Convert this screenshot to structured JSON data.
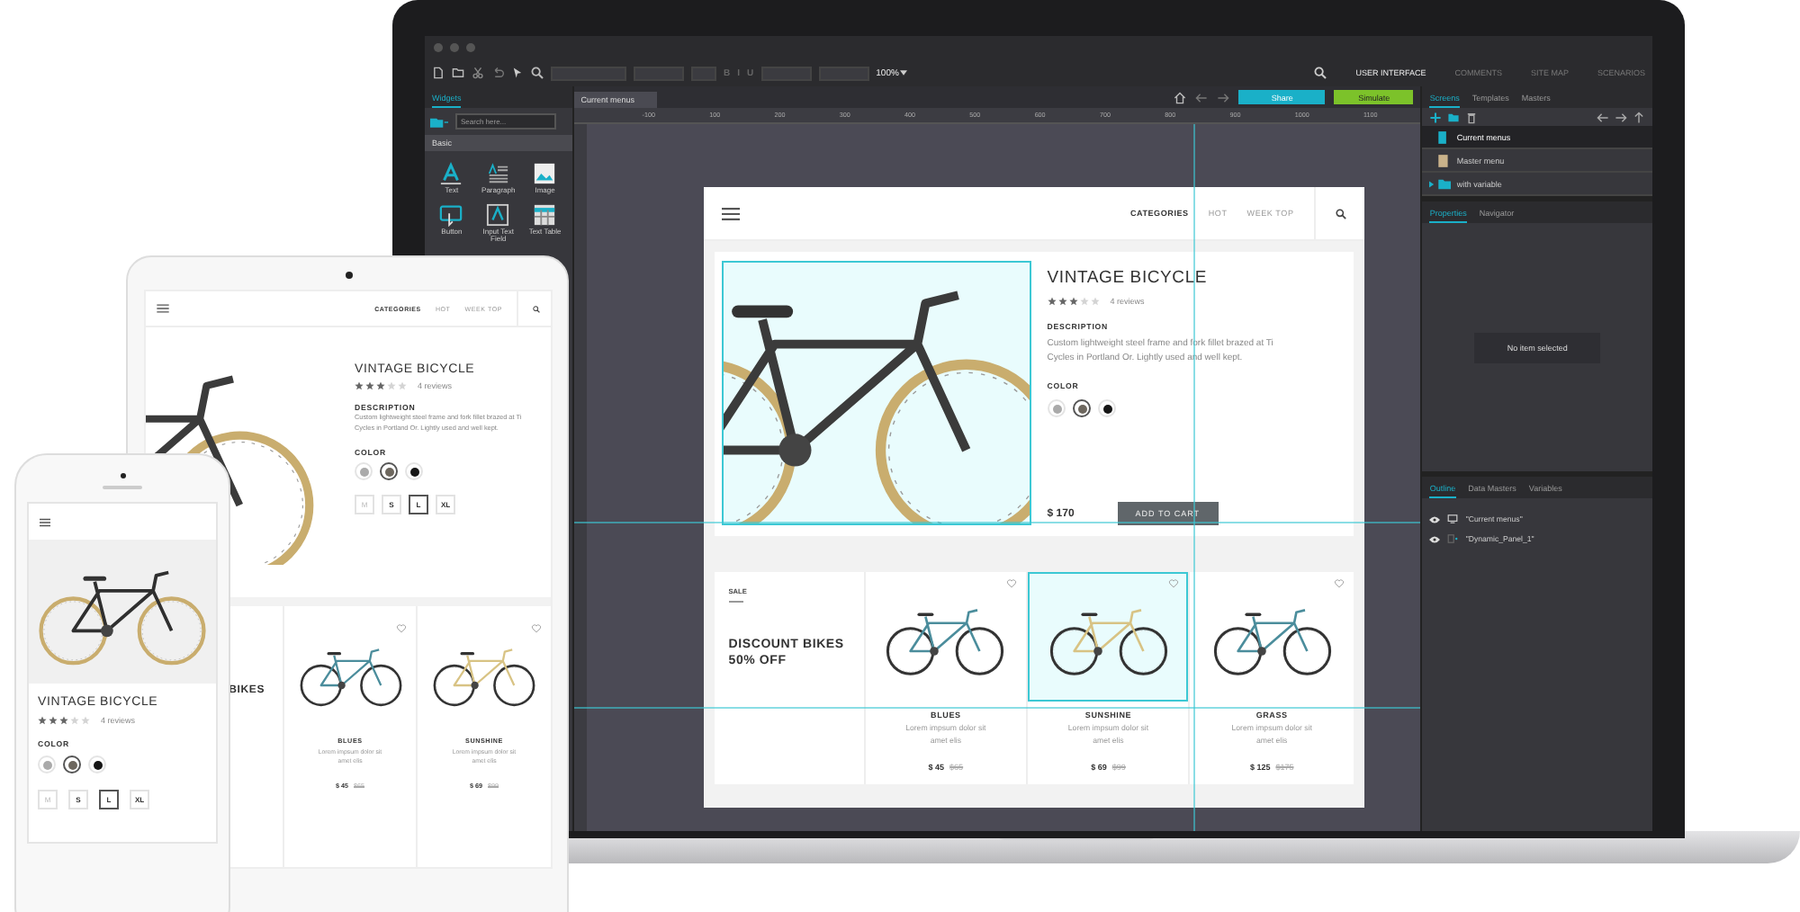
{
  "laptop": {
    "toolbar": {
      "format_buttons": [
        "B",
        "I",
        "U"
      ],
      "zoom": "100%",
      "modes": [
        {
          "label": "USER INTERFACE",
          "selected": true
        },
        {
          "label": "COMMENTS",
          "selected": false
        },
        {
          "label": "SITE MAP",
          "selected": false
        },
        {
          "label": "SCENARIOS",
          "selected": false
        }
      ]
    },
    "widgets_panel": {
      "tab": "Widgets",
      "search": {
        "placeholder": "Search here..."
      },
      "category": "Basic",
      "widgets": [
        {
          "label": "Text",
          "kind": "text"
        },
        {
          "label": "Paragraph",
          "kind": "paragraph"
        },
        {
          "label": "Image",
          "kind": "image"
        },
        {
          "label": "Button",
          "kind": "button"
        },
        {
          "label": "Input Text Field",
          "kind": "input"
        },
        {
          "label": "Text Table",
          "kind": "table"
        }
      ]
    },
    "document_tab": "Current menus",
    "share_button": "Share",
    "simulate_button": "Simulate",
    "ruler": [
      "-100",
      "100",
      "200",
      "300",
      "400",
      "500",
      "600",
      "700",
      "800",
      "900",
      "1000",
      "1100"
    ],
    "page": {
      "nav": [
        {
          "label": "CATEGORIES",
          "selected": true
        },
        {
          "label": "HOT",
          "selected": false
        },
        {
          "label": "WEEK TOP",
          "selected": false
        }
      ],
      "product": {
        "image_selected": true,
        "title": "VINTAGE BICYCLE",
        "stars": 3,
        "reviews": "4 reviews",
        "description_heading": "DESCRIPTION",
        "description": "Custom lightweight steel frame and fork fillet brazed at Ti Cycles in Portland Or. Lightly used and well kept.",
        "color_heading": "COLOR",
        "colors": [
          {
            "color": "#aaaaaa",
            "selected": false
          },
          {
            "color": "#6d675e",
            "selected": true
          },
          {
            "color": "#161616",
            "selected": false
          }
        ],
        "price": "$ 170",
        "cart_button": "ADD TO CART"
      },
      "sale": {
        "label": "SALE",
        "title": "DISCOUNT BIKES 50% OFF"
      },
      "products": [
        {
          "name": "BLUES",
          "description": "Lorem impsum dolor sit amet elis",
          "price": "$ 45",
          "old_price": "$65",
          "color": "#4b8d9c",
          "selected": false
        },
        {
          "name": "SUNSHINE",
          "description": "Lorem impsum dolor sit amet elis",
          "price": "$ 69",
          "old_price": "$99",
          "color": "#d8c384",
          "selected": true
        },
        {
          "name": "GRASS",
          "description": "Lorem impsum dolor sit amet elis",
          "price": "$ 125",
          "old_price": "$175",
          "color": "#4b8d9c",
          "selected": false
        }
      ]
    },
    "screens_panel": {
      "tabs": [
        {
          "label": "Screens",
          "selected": true
        },
        {
          "label": "Templates",
          "selected": false
        },
        {
          "label": "Masters",
          "selected": false
        }
      ],
      "items": [
        {
          "label": "Current menus",
          "kind": "screen",
          "selected": true
        },
        {
          "label": "Master menu",
          "kind": "master",
          "selected": false
        },
        {
          "label": "with variable",
          "kind": "folder",
          "selected": false
        }
      ]
    },
    "properties_panel": {
      "tabs": [
        {
          "label": "Properties",
          "selected": true
        },
        {
          "label": "Navigator",
          "selected": false
        }
      ],
      "empty_message": "No item selected"
    },
    "outline_panel": {
      "tabs": [
        {
          "label": "Outline",
          "selected": true
        },
        {
          "label": "Data Masters",
          "selected": false
        },
        {
          "label": "Variables",
          "selected": false
        }
      ],
      "items": [
        {
          "label": "\"Current menus\"",
          "kind": "screen"
        },
        {
          "label": "\"Dynamic_Panel_1\"",
          "kind": "panel"
        }
      ]
    }
  },
  "tablet": {
    "nav": [
      {
        "label": "CATEGORIES",
        "selected": true
      },
      {
        "label": "HOT",
        "selected": false
      },
      {
        "label": "WEEK TOP",
        "selected": false
      }
    ],
    "product": {
      "title": "VINTAGE BICYCLE",
      "stars": 3,
      "reviews": "4 reviews",
      "description_heading": "DESCRIPTION",
      "description": "Custom lightweight steel frame and fork fillet brazed at Ti Cycles in Portland Or. Lightly used and well kept.",
      "color_heading": "COLOR",
      "colors": [
        {
          "color": "#aaaaaa",
          "selected": false
        },
        {
          "color": "#6d675e",
          "selected": true
        },
        {
          "color": "#161616",
          "selected": false
        }
      ],
      "sizes": [
        {
          "label": "M",
          "selected": false,
          "disabled": true
        },
        {
          "label": "S",
          "selected": false,
          "disabled": false
        },
        {
          "label": "L",
          "selected": true,
          "disabled": false
        },
        {
          "label": "XL",
          "selected": false,
          "disabled": false
        }
      ]
    },
    "sale_title": "BIKES",
    "products": [
      {
        "name": "BLUES",
        "description": "Lorem impsum dolor sit amet elis",
        "price": "$ 45",
        "old_price": "$65",
        "color": "#4b8d9c"
      },
      {
        "name": "SUNSHINE",
        "description": "Lorem impsum dolor sit amet elis",
        "price": "$ 69",
        "old_price": "$99",
        "color": "#d8c384"
      }
    ]
  },
  "phone": {
    "product": {
      "title": "VINTAGE BICYCLE",
      "stars": 3,
      "reviews": "4 reviews",
      "color_heading": "COLOR",
      "colors": [
        {
          "color": "#aaaaaa",
          "selected": false
        },
        {
          "color": "#6d675e",
          "selected": true
        },
        {
          "color": "#161616",
          "selected": false
        }
      ],
      "sizes": [
        {
          "label": "M",
          "selected": false,
          "disabled": true
        },
        {
          "label": "S",
          "selected": false,
          "disabled": false
        },
        {
          "label": "L",
          "selected": true,
          "disabled": false
        },
        {
          "label": "XL",
          "selected": false,
          "disabled": false
        }
      ]
    }
  }
}
